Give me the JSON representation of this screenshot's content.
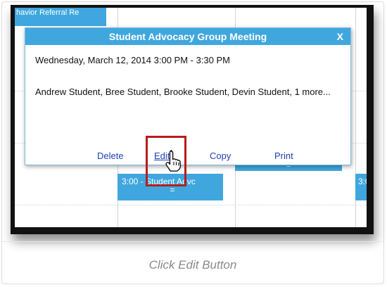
{
  "calendar": {
    "event_top_label": "havior Referral Re",
    "event_mid_label": "3:00 - Student Advc",
    "event_mid_marker": "=",
    "event_strip_marker": "=",
    "event_right_label": "3:0"
  },
  "popup": {
    "title": "Student Advocacy Group Meeting",
    "close_label": "X",
    "datetime": "Wednesday, March 12, 2014 3:00 PM - 3:30 PM",
    "attendees": "Andrew Student, Bree Student, Brooke Student, Devin Student, 1 more...",
    "actions": {
      "delete": "Delete",
      "edit": "Edit",
      "copy": "Copy",
      "print": "Print"
    }
  },
  "caption": "Click Edit Button",
  "colors": {
    "accent": "#3fa7de",
    "highlight": "#b71c1c",
    "link": "#1f3fb3"
  },
  "icons": {
    "pointer": "hand-pointer-icon"
  }
}
